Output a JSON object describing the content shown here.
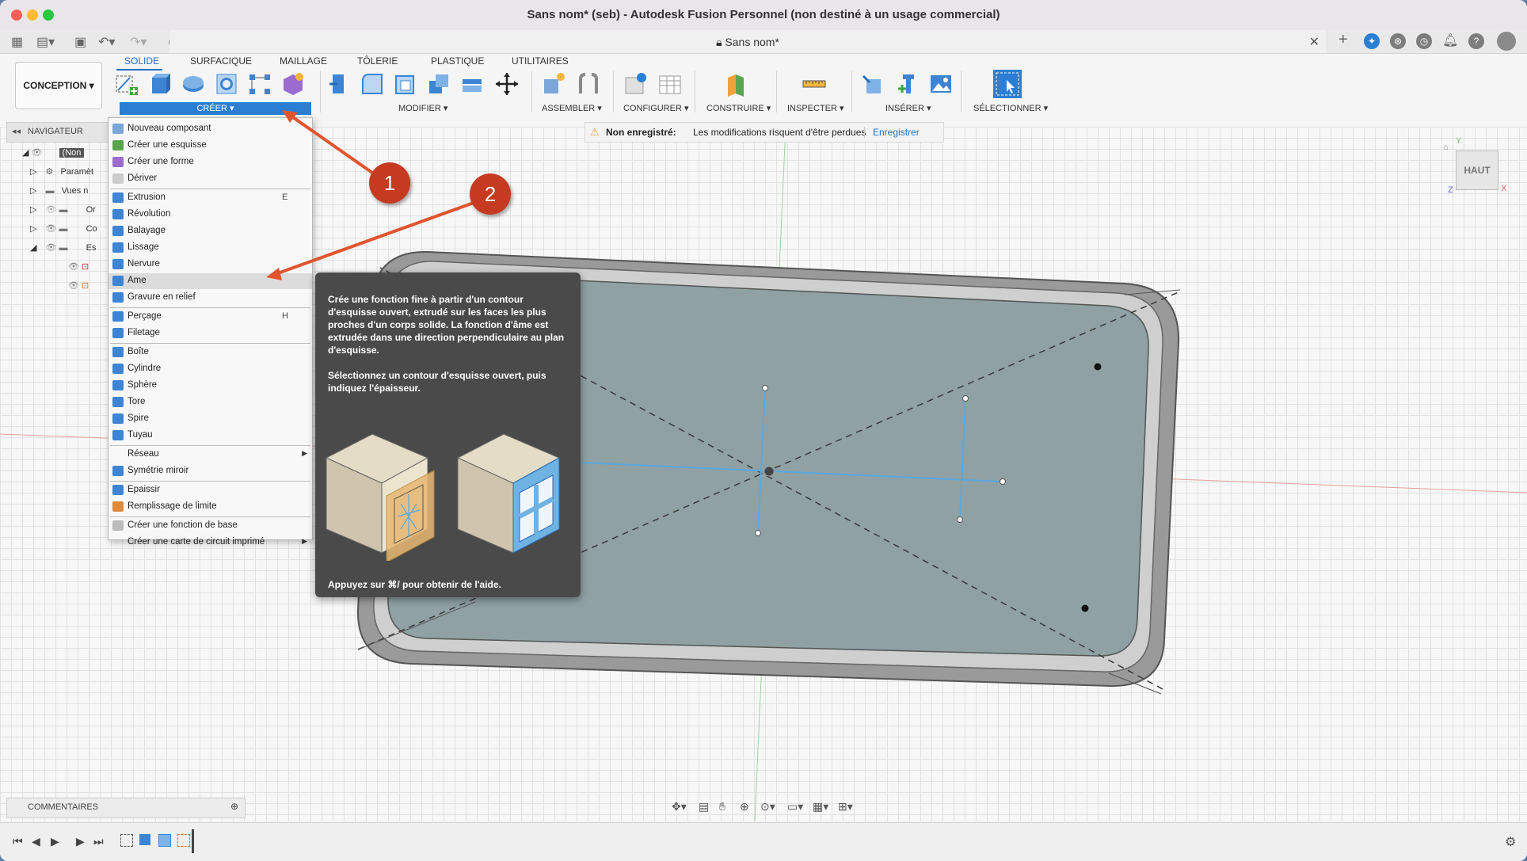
{
  "window": {
    "title": "Sans nom* (seb) - Autodesk Fusion Personnel (non destiné à un usage commercial)",
    "document_tab": "Sans nom*"
  },
  "ribbon": {
    "workspace_label": "CONCEPTION",
    "tabs": [
      "SOLIDE",
      "SURFACIQUE",
      "MAILLAGE",
      "TÔLERIE",
      "PLASTIQUE",
      "UTILITAIRES"
    ],
    "active_tab": "SOLIDE",
    "groups": {
      "creer": "CRÉER ▾",
      "modifier": "MODIFIER ▾",
      "assembler": "ASSEMBLER ▾",
      "configurer": "CONFIGURER ▾",
      "construire": "CONSTRUIRE ▾",
      "inspecter": "INSPECTER ▾",
      "inserer": "INSÉRER ▾",
      "selectionner": "SÉLECTIONNER ▾"
    }
  },
  "navigator": {
    "title": "NAVIGATEUR",
    "rows": [
      "(Non",
      "Paramèt",
      "Vues n",
      "Or",
      "Co",
      "Es"
    ]
  },
  "notice": {
    "status": "Non enregistré:",
    "message": "Les modifications risquent d'être perdues",
    "save_link": "Enregistrer"
  },
  "viewcube": {
    "face": "HAUT",
    "axis_y": "Y",
    "axis_x": "X",
    "axis_z": "Z"
  },
  "menu": {
    "items": [
      {
        "label": "Nouveau composant",
        "key": "",
        "icon": "component-icon",
        "color": "#7aa6d8"
      },
      {
        "label": "Créer une esquisse",
        "key": "",
        "icon": "sketch-icon",
        "color": "#5ca54f"
      },
      {
        "label": "Créer une forme",
        "key": "",
        "icon": "form-icon",
        "color": "#9c6bd0"
      },
      {
        "label": "Dériver",
        "key": "",
        "icon": "derive-icon",
        "color": "#cccccc"
      },
      {
        "label": "Extrusion",
        "key": "E",
        "icon": "extrude-icon",
        "color": "#3d85d4"
      },
      {
        "label": "Révolution",
        "key": "",
        "icon": "revolve-icon",
        "color": "#3d85d4"
      },
      {
        "label": "Balayage",
        "key": "",
        "icon": "sweep-icon",
        "color": "#3d85d4"
      },
      {
        "label": "Lissage",
        "key": "",
        "icon": "loft-icon",
        "color": "#3d85d4"
      },
      {
        "label": "Nervure",
        "key": "",
        "icon": "rib-icon",
        "color": "#3d85d4"
      },
      {
        "label": "Ame",
        "key": "",
        "icon": "web-icon",
        "color": "#3d85d4"
      },
      {
        "label": "Gravure en relief",
        "key": "",
        "icon": "emboss-icon",
        "color": "#3d85d4"
      },
      {
        "label": "Perçage",
        "key": "H",
        "icon": "hole-icon",
        "color": "#3d85d4"
      },
      {
        "label": "Filetage",
        "key": "",
        "icon": "thread-icon",
        "color": "#3d85d4"
      },
      {
        "label": "Boîte",
        "key": "",
        "icon": "box-icon",
        "color": "#3d85d4"
      },
      {
        "label": "Cylindre",
        "key": "",
        "icon": "cylinder-icon",
        "color": "#3d85d4"
      },
      {
        "label": "Sphère",
        "key": "",
        "icon": "sphere-icon",
        "color": "#3d85d4"
      },
      {
        "label": "Tore",
        "key": "",
        "icon": "torus-icon",
        "color": "#3d85d4"
      },
      {
        "label": "Spire",
        "key": "",
        "icon": "coil-icon",
        "color": "#3d85d4"
      },
      {
        "label": "Tuyau",
        "key": "",
        "icon": "pipe-icon",
        "color": "#3d85d4"
      },
      {
        "label": "Réseau",
        "key": "",
        "icon": "",
        "color": ""
      },
      {
        "label": "Symétrie miroir",
        "key": "",
        "icon": "mirror-icon",
        "color": "#3d85d4"
      },
      {
        "label": "Epaissir",
        "key": "",
        "icon": "thicken-icon",
        "color": "#3d85d4"
      },
      {
        "label": "Remplissage de limite",
        "key": "",
        "icon": "boundary-fill-icon",
        "color": "#e08a3c"
      },
      {
        "label": "Créer une fonction de base",
        "key": "",
        "icon": "base-feature-icon",
        "color": "#bbbbbb"
      },
      {
        "label": "Créer une carte de circuit imprimé",
        "key": "",
        "icon": "",
        "color": ""
      }
    ]
  },
  "tooltip": {
    "description": "Crée une fonction fine à partir d'un contour d'esquisse ouvert, extrudé sur les faces les plus proches d'un corps solide. La fonction d'âme est extrudée dans une direction perpendiculaire au plan d'esquisse.",
    "instruction": "Sélectionnez un contour d'esquisse ouvert, puis indiquez l'épaisseur.",
    "help": "Appuyez sur ⌘/ pour obtenir de l'aide."
  },
  "comments": {
    "label": "COMMENTAIRES"
  },
  "callouts": [
    "1",
    "2"
  ],
  "colors": {
    "accent": "#2a7fd4",
    "callout": "#c53a20"
  }
}
